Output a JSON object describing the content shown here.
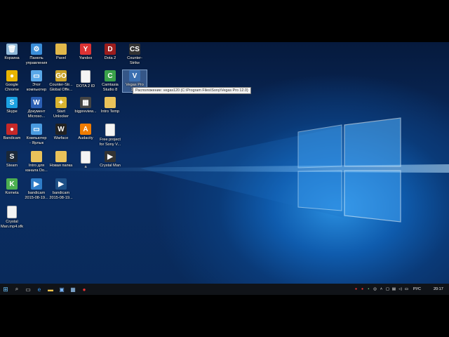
{
  "desktop": {
    "icons": [
      {
        "label": "Корзина",
        "icon": "recycle-bin-icon",
        "color": "#8fb8d8",
        "glyph": "🗑"
      },
      {
        "label": "Панель\nуправления",
        "icon": "control-panel-icon",
        "color": "#3b8ed8",
        "glyph": "⚙"
      },
      {
        "label": "Pavel",
        "icon": "user-folder-icon",
        "color": "#e2b84a",
        "glyph": ""
      },
      {
        "label": "Yandex",
        "icon": "yandex-browser-icon",
        "color": "#d33",
        "glyph": "Y"
      },
      {
        "label": "Dota 2",
        "icon": "dota2-icon",
        "color": "#9b1d1d",
        "glyph": "D"
      },
      {
        "label": "Counter-Strike",
        "icon": "counter-strike-icon",
        "color": "#333",
        "glyph": "CS"
      },
      {
        "label": "Google\nChrome",
        "icon": "chrome-icon",
        "color": "#e8b400",
        "glyph": "●"
      },
      {
        "label": "Этот\nкомпьютер",
        "icon": "this-pc-icon",
        "color": "#5aa8e8",
        "glyph": "▭"
      },
      {
        "label": "Counter-Str...\nGlobal Offe...",
        "icon": "csgo-icon",
        "color": "#c9a227",
        "glyph": "GO"
      },
      {
        "label": "DOTA 2 ID",
        "icon": "text-file-icon",
        "color": "#f4f4f4",
        "glyph": ""
      },
      {
        "label": "Camtasia\nStudio 8",
        "icon": "camtasia-icon",
        "color": "#3aa14a",
        "glyph": "C"
      },
      {
        "label": "Vegas Pro\n12.0",
        "icon": "vegas-pro-icon",
        "color": "#3b6fb0",
        "glyph": "V"
      },
      {
        "label": "Skype",
        "icon": "skype-icon",
        "color": "#1ba1e2",
        "glyph": "S"
      },
      {
        "label": "Документ\nMicroso...",
        "icon": "word-document-icon",
        "color": "#2b5fb4",
        "glyph": "W"
      },
      {
        "label": "Start\nUnlocker",
        "icon": "unlocker-icon",
        "color": "#d9b330",
        "glyph": "✦"
      },
      {
        "label": "bigpreview...",
        "icon": "image-file-icon",
        "color": "#444",
        "glyph": "▦"
      },
      {
        "label": "Intro Temp",
        "icon": "folder-icon",
        "color": "#e9c25a",
        "glyph": ""
      },
      {
        "label": "Bandicam",
        "icon": "bandicam-icon",
        "color": "#c62828",
        "glyph": "●"
      },
      {
        "label": "Компьютер\n- Ярлык",
        "icon": "computer-shortcut-icon",
        "color": "#4a9be0",
        "glyph": "▭"
      },
      {
        "label": "Warface",
        "icon": "warface-icon",
        "color": "#222",
        "glyph": "W"
      },
      {
        "label": "Audacity",
        "icon": "audacity-icon",
        "color": "#f07c00",
        "glyph": "A"
      },
      {
        "label": "Free project\nfor Sony V...",
        "icon": "document-icon",
        "color": "#f4f4f4",
        "glyph": ""
      },
      {
        "label": "Steam",
        "icon": "steam-icon",
        "color": "#1b2838",
        "glyph": "S"
      },
      {
        "label": "Intro для\nканала Do...",
        "icon": "folder-icon",
        "color": "#e9c25a",
        "glyph": ""
      },
      {
        "label": "Новая папка",
        "icon": "folder-icon",
        "color": "#e9c25a",
        "glyph": ""
      },
      {
        "label": "a",
        "icon": "document-icon",
        "color": "#f4f4f4",
        "glyph": ""
      },
      {
        "label": "Crystal Man",
        "icon": "media-file-icon",
        "color": "#333",
        "glyph": "▶"
      },
      {
        "label": "Kometa",
        "icon": "kometa-icon",
        "color": "#4caf50",
        "glyph": "K"
      },
      {
        "label": "bandicam\n2015-08-19...",
        "icon": "video-file-icon",
        "color": "#2f7dc8",
        "glyph": "▶"
      },
      {
        "label": "bandicam\n2015-08-19...",
        "icon": "video-file-icon",
        "color": "#1d4f86",
        "glyph": "▶"
      },
      {
        "label": "Crystal\nMan.mp4.sfk",
        "icon": "sfk-file-icon",
        "color": "#f4f4f4",
        "glyph": ""
      }
    ],
    "tooltip": "Расположение: vegas120 (C:\\Program Files\\Sony\\Vegas Pro 12.0)"
  },
  "taskbar": {
    "language": "РУС",
    "time": "20:17"
  }
}
